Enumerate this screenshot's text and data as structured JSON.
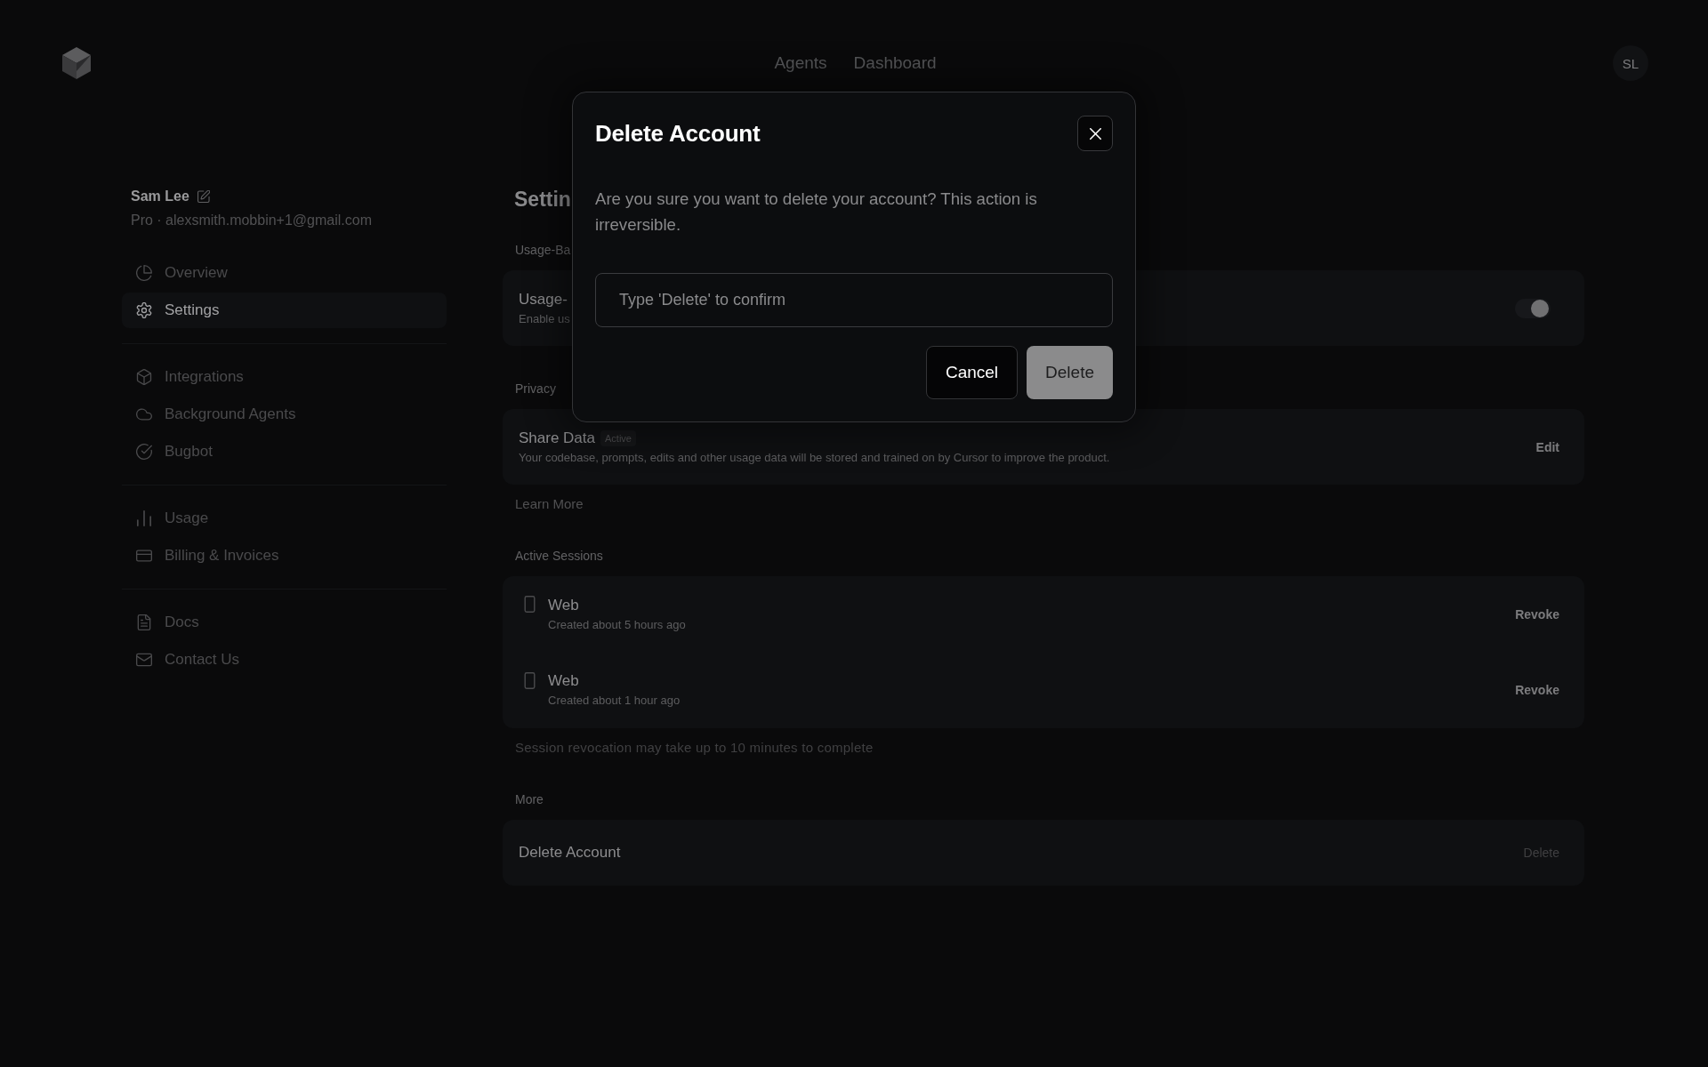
{
  "header": {
    "nav": [
      {
        "label": "Agents"
      },
      {
        "label": "Dashboard"
      }
    ],
    "avatar": "SL"
  },
  "sidebar": {
    "user": {
      "name": "Sam Lee",
      "subtitle": "Pro · alexsmith.mobbin+1@gmail.com"
    },
    "groups": [
      {
        "items": [
          {
            "label": "Overview",
            "kind": "overview",
            "selected": false
          },
          {
            "label": "Settings",
            "kind": "settings",
            "selected": true
          }
        ]
      },
      {
        "items": [
          {
            "label": "Integrations",
            "kind": "integrations",
            "selected": false
          },
          {
            "label": "Background Agents",
            "kind": "agents",
            "selected": false
          },
          {
            "label": "Bugbot",
            "kind": "bugbot",
            "selected": false
          }
        ]
      },
      {
        "items": [
          {
            "label": "Usage",
            "kind": "usage",
            "selected": false
          },
          {
            "label": "Billing & Invoices",
            "kind": "billing",
            "selected": false
          }
        ]
      },
      {
        "items": [
          {
            "label": "Docs",
            "kind": "docs",
            "selected": false
          },
          {
            "label": "Contact Us",
            "kind": "contact",
            "selected": false
          }
        ]
      }
    ]
  },
  "main": {
    "title": "Settin",
    "sections": [
      {
        "label": "Usage-Ba",
        "rows": [
          {
            "kind": "toggle",
            "title": "Usage-",
            "description": "Enable us",
            "on": true
          }
        ]
      },
      {
        "label": "Privacy",
        "rows": [
          {
            "kind": "info",
            "title": "Share Data",
            "badge": "Active",
            "description": "Your codebase, prompts, edits and other usage data will be stored and trained on by Cursor to improve the product.",
            "action": "Edit",
            "disabled": false
          }
        ],
        "footer": {
          "kind": "link",
          "text": "Learn More"
        }
      },
      {
        "label": "Active Sessions",
        "rows": [
          {
            "kind": "session",
            "title": "Web",
            "description": "Created about 5 hours ago",
            "action": "Revoke",
            "disabled": false
          },
          {
            "kind": "session",
            "title": "Web",
            "description": "Created about 1 hour ago",
            "action": "Revoke",
            "disabled": false
          }
        ],
        "footer": {
          "kind": "note",
          "text": "Session revocation may take up to 10 minutes to complete"
        }
      },
      {
        "label": "More",
        "rows": [
          {
            "kind": "action",
            "title": "Delete Account",
            "action": "Delete",
            "disabled": true
          }
        ]
      }
    ]
  },
  "modal": {
    "title": "Delete Account",
    "message": "Are you sure you want to delete your account? This action is irreversible.",
    "input": {
      "placeholder": "Type 'Delete' to confirm"
    },
    "buttons": [
      {
        "label": "Cancel",
        "kind": "secondary",
        "disabled": false
      },
      {
        "label": "Delete",
        "kind": "primary",
        "disabled": true
      }
    ]
  }
}
